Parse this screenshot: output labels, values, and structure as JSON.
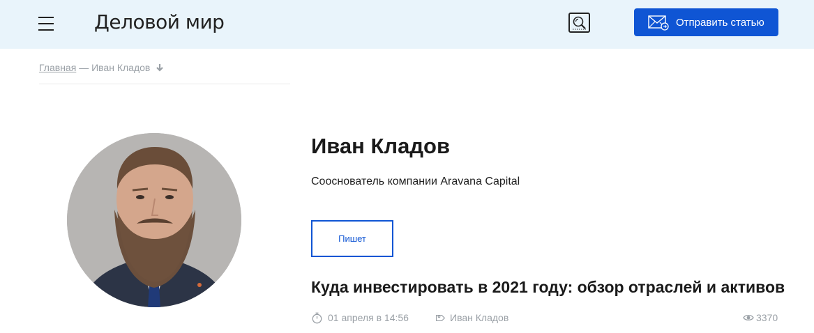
{
  "header": {
    "logo": "Деловой мир",
    "send_article_label": "Отправить статью",
    "icons": [
      "menu-icon",
      "search-icon",
      "mail-icon"
    ]
  },
  "breadcrumb": {
    "home": "Главная",
    "separator": "—",
    "current": "Иван Кладов"
  },
  "author": {
    "name": "Иван Кладов",
    "role": "Сооснователь компании Aravana Capital",
    "tab_label": "Пишет"
  },
  "article": {
    "title": "Куда инвестировать в 2021 году: обзор отраслей и активов",
    "date": "01 апреля в 14:56",
    "author": "Иван Кладов",
    "views": "3370"
  },
  "colors": {
    "header_bg": "#e9f4fb",
    "accent": "#0f55d4",
    "meta_text": "#9aa0a6"
  }
}
